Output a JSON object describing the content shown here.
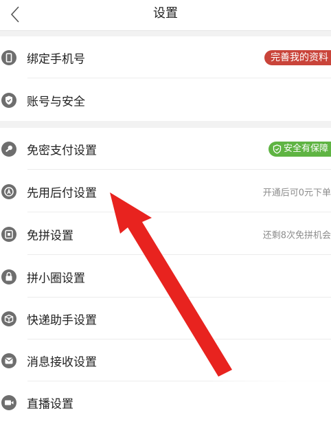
{
  "nav": {
    "title": "设置",
    "back_icon": "chevron-left-icon"
  },
  "section1": [
    {
      "id": "bind-phone",
      "label": "绑定手机号",
      "icon": "phone-icon",
      "badge": "完善我的资料",
      "badge_color": "#c9443a"
    },
    {
      "id": "account-security",
      "label": "账号与安全",
      "icon": "shield-check-icon"
    }
  ],
  "section2": [
    {
      "id": "password-free-pay",
      "label": "免密支付设置",
      "icon": "key-icon",
      "badge": "安全有保障",
      "badge_color": "#5fb443"
    },
    {
      "id": "pay-later",
      "label": "先用后付设置",
      "icon": "pay-later-icon",
      "value": "开通后可0元下单"
    },
    {
      "id": "group-free",
      "label": "免拼设置",
      "icon": "free-group-icon",
      "value": "还剩8次免拼机会"
    },
    {
      "id": "circle",
      "label": "拼小圈设置",
      "icon": "lock-icon"
    },
    {
      "id": "courier-assistant",
      "label": "快递助手设置",
      "icon": "courier-icon"
    },
    {
      "id": "message-receive",
      "label": "消息接收设置",
      "icon": "message-icon"
    },
    {
      "id": "live",
      "label": "直播设置",
      "icon": "live-icon"
    }
  ],
  "annotation": {
    "arrow_color": "#e8231f"
  }
}
